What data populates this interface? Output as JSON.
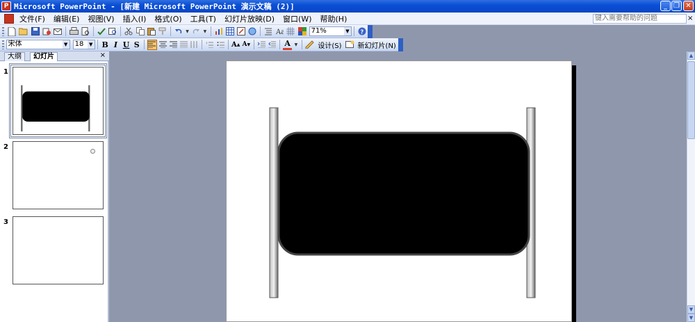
{
  "window": {
    "app_icon": "P",
    "title": "Microsoft PowerPoint - [新建 Microsoft PowerPoint 演示文稿 (2)]",
    "minimize_icon": "_",
    "restore_icon": "❐",
    "close_icon": "✕"
  },
  "menu": {
    "items": [
      "文件(F)",
      "编辑(E)",
      "视图(V)",
      "插入(I)",
      "格式(O)",
      "工具(T)",
      "幻灯片放映(D)",
      "窗口(W)",
      "帮助(H)"
    ],
    "help_search_placeholder": "键入需要帮助的问题",
    "close_glyph": "×"
  },
  "toolbar_standard": {
    "zoom_value": "71%",
    "icons": [
      "new-icon",
      "open-icon",
      "save-icon",
      "permission-icon",
      "email-icon",
      "print-icon",
      "print-preview-icon",
      "spelling-icon",
      "research-icon",
      "cut-icon",
      "copy-icon",
      "paste-icon",
      "format-painter-icon",
      "undo-icon",
      "redo-icon",
      "insert-chart-icon",
      "insert-table-icon",
      "tables-borders-icon",
      "insert-hyperlink-icon",
      "expand-all-icon",
      "show-formatting-icon",
      "show-grid-icon",
      "color-grayscale-icon",
      "help-icon"
    ]
  },
  "toolbar_format": {
    "font_name": "宋体",
    "font_size": "18",
    "bold": "B",
    "italic": "I",
    "underline": "U",
    "shadow": "S",
    "font_color_label": "A",
    "grow_font": "A",
    "shrink_font": "A",
    "design_label": "设计(S)",
    "new_slide_label": "新幻灯片(N)"
  },
  "pane": {
    "tab_outline": "大纲",
    "tab_slides": "幻灯片",
    "close_glyph": "×",
    "slides": [
      {
        "number": "1",
        "selected": true
      },
      {
        "number": "2",
        "selected": false
      },
      {
        "number": "3",
        "selected": false
      }
    ]
  },
  "colors": {
    "title_bar": "#0a4fd6",
    "workspace_bg": "#8f97ad",
    "shape_fill": "#000000",
    "format_active": "#f8c56f"
  },
  "scrollbar": {
    "up_glyph": "▲",
    "down_glyph": "▼"
  }
}
